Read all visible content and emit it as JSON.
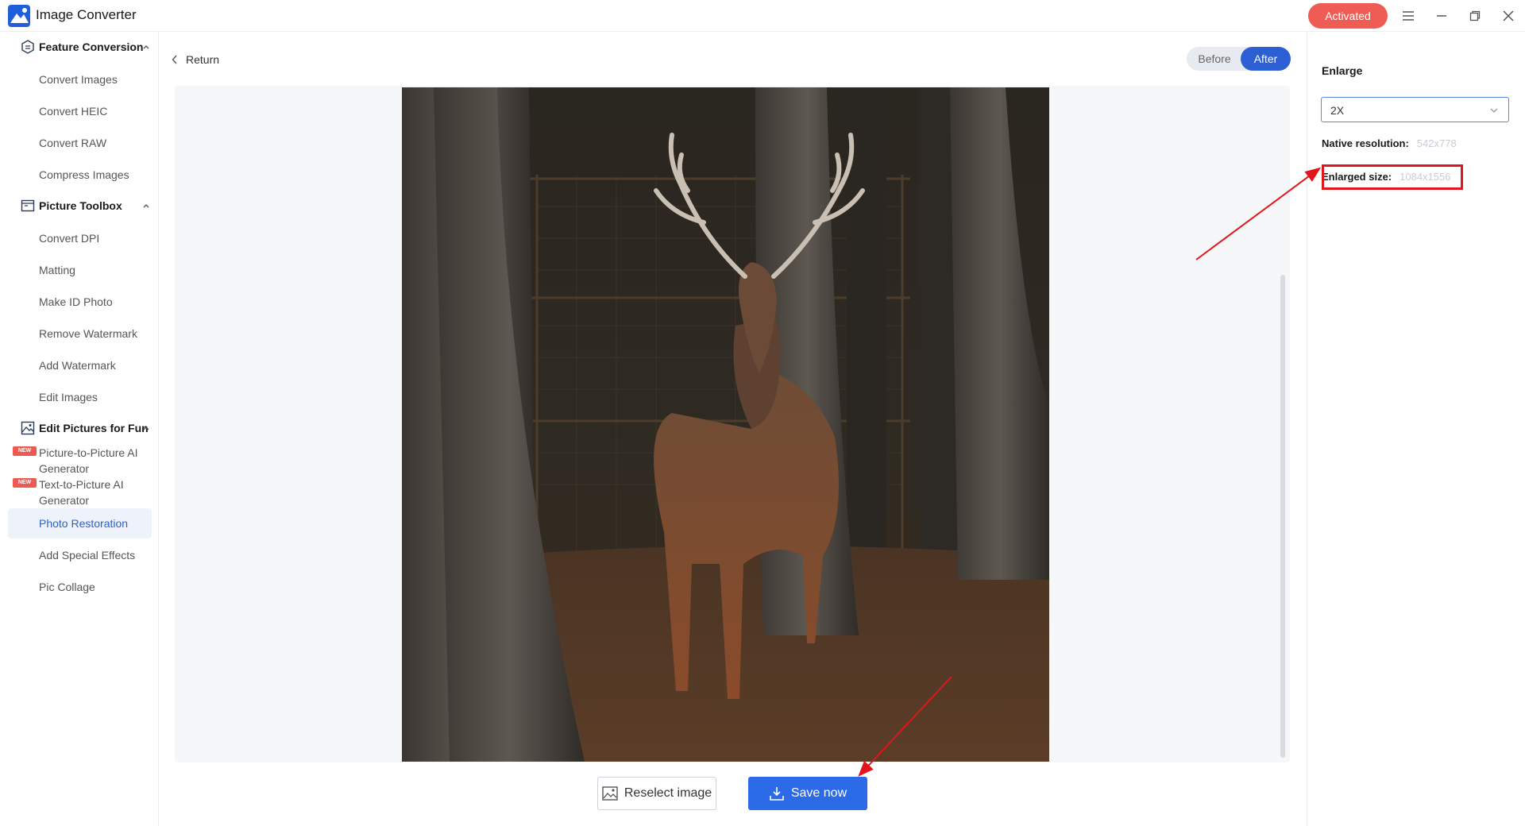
{
  "app": {
    "title": "Image Converter",
    "activated_label": "Activated"
  },
  "sidebar": {
    "sections": [
      {
        "label": "Feature Conversion",
        "items": [
          "Convert Images",
          "Convert HEIC",
          "Convert RAW",
          "Compress Images"
        ]
      },
      {
        "label": "Picture Toolbox",
        "items": [
          "Convert DPI",
          "Matting",
          "Make ID Photo",
          "Remove Watermark",
          "Add Watermark",
          "Edit Images"
        ]
      },
      {
        "label": "Edit Pictures for Fun",
        "items": [
          "Picture-to-Picture AI Generator",
          "Text-to-Picture AI Generator",
          "Photo Restoration",
          "Add Special Effects",
          "Pic Collage"
        ]
      }
    ],
    "new_badge": "NEW",
    "active_item": "Photo Restoration"
  },
  "main": {
    "return_label": "Return",
    "toggle": {
      "before": "Before",
      "after": "After",
      "selected": "After"
    },
    "reselect_label": "Reselect image",
    "save_label": "Save now"
  },
  "right_panel": {
    "enlarge_title": "Enlarge",
    "enlarge_value": "2X",
    "native_label": "Native resolution:",
    "native_value": "542x778",
    "enlarged_label": "Enlarged size:",
    "enlarged_value": "1084x1556"
  },
  "colors": {
    "accent": "#2c5fd4",
    "save_button": "#2c6be8",
    "activated": "#ef5b55",
    "annotation": "#e0161c"
  },
  "icons": [
    "app-logo-icon",
    "menu-icon",
    "minimize-icon",
    "restore-icon",
    "close-icon",
    "chevron-left-icon",
    "chevron-up-icon",
    "chevron-down-icon",
    "image-icon",
    "download-icon"
  ]
}
